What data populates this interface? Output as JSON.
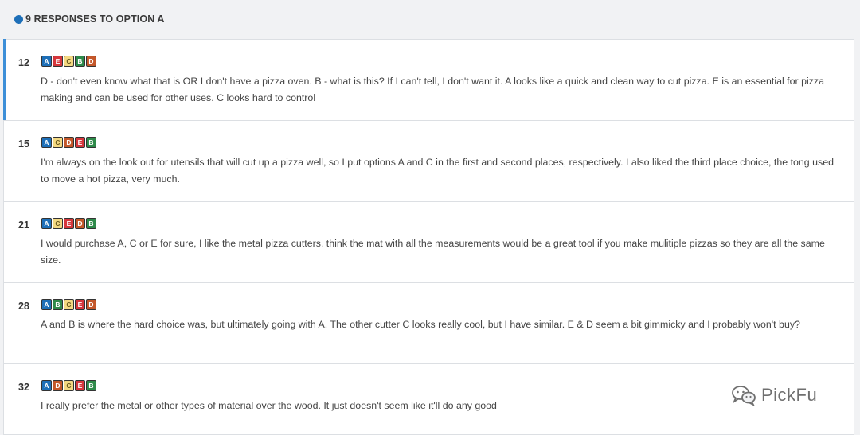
{
  "header": {
    "title": "9 RESPONSES TO OPTION A"
  },
  "responses": [
    {
      "id": "12",
      "ranking": [
        "A",
        "E",
        "C",
        "B",
        "D"
      ],
      "text": "D - don't even know what that is OR I don't have a pizza oven. B - what is this? If I can't tell, I don't want it. A looks like a quick and clean way to cut pizza. E is an essential for pizza making and can be used for other uses. C looks hard to control"
    },
    {
      "id": "15",
      "ranking": [
        "A",
        "C",
        "D",
        "E",
        "B"
      ],
      "text": "I'm always on the look out for utensils that will cut up a pizza well, so I put options A and C in the first and second places, respectively. I also liked the third place choice, the tong used to move a hot pizza, very much."
    },
    {
      "id": "21",
      "ranking": [
        "A",
        "C",
        "E",
        "D",
        "B"
      ],
      "text": "I would purchase A, C or E for sure, I like the metal pizza cutters. think the mat with all the measurements would be a great tool if you make mulitiple pizzas so they are all the same size."
    },
    {
      "id": "28",
      "ranking": [
        "A",
        "B",
        "C",
        "E",
        "D"
      ],
      "text": "A and B is where the hard choice was, but ultimately going with A. The other cutter C looks really cool, but I have similar. E & D seem a bit gimmicky and I probably won't buy?"
    },
    {
      "id": "32",
      "ranking": [
        "A",
        "D",
        "C",
        "E",
        "B"
      ],
      "text": "I really prefer the metal or other types of material over the wood. It just doesn't seem like it'll do any good"
    }
  ],
  "watermark": {
    "label": "PickFu",
    "icon": "wechat-icon"
  },
  "colors": {
    "A": "#1d6fb8",
    "B": "#2e8a4a",
    "C": "#f4d982",
    "D": "#c4572a",
    "E": "#d6373d",
    "accent": "#3d8fd8"
  }
}
